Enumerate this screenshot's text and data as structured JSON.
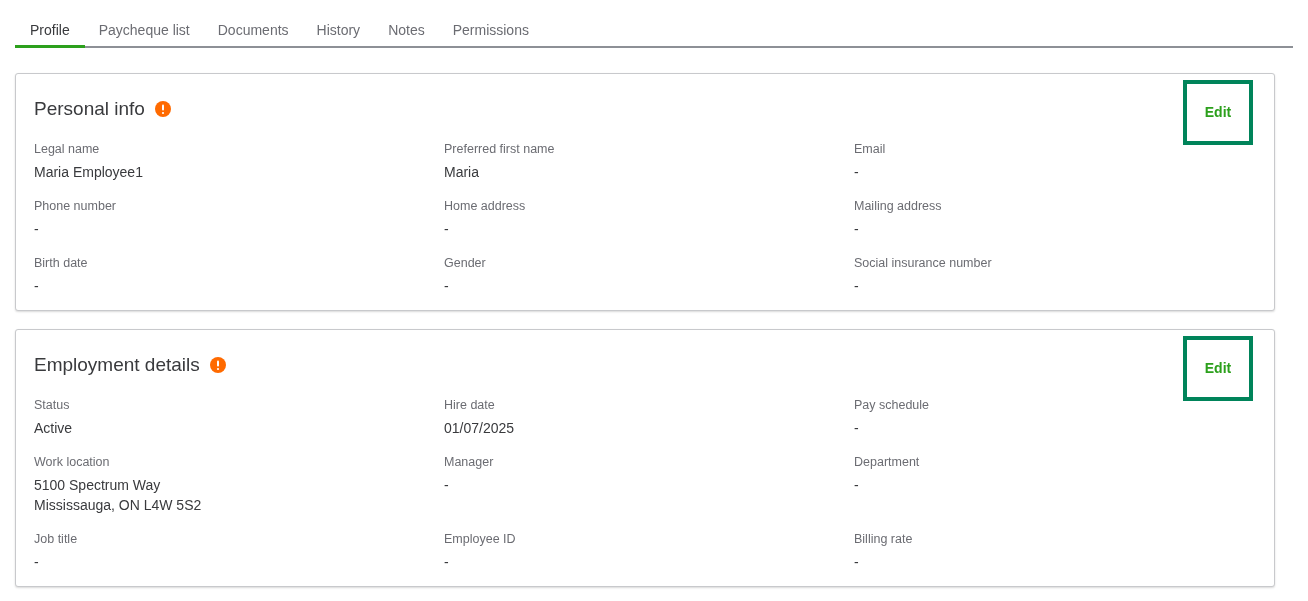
{
  "tabs": [
    {
      "label": "Profile",
      "selected": true
    },
    {
      "label": "Paycheque list",
      "selected": false
    },
    {
      "label": "Documents",
      "selected": false
    },
    {
      "label": "History",
      "selected": false
    },
    {
      "label": "Notes",
      "selected": false
    },
    {
      "label": "Permissions",
      "selected": false
    }
  ],
  "sections": [
    {
      "title": "Personal info",
      "warning": true,
      "edit": {
        "label": "Edit",
        "highlighted": true
      },
      "fields": [
        {
          "label": "Legal name",
          "value": "Maria Employee1"
        },
        {
          "label": "Preferred first name",
          "value": "Maria"
        },
        {
          "label": "Email",
          "value": "-"
        },
        {
          "label": "Phone number",
          "value": "-"
        },
        {
          "label": "Home address",
          "value": "-"
        },
        {
          "label": "Mailing address",
          "value": "-"
        },
        {
          "label": "Birth date",
          "value": "-"
        },
        {
          "label": "Gender",
          "value": "-"
        },
        {
          "label": "Social insurance number",
          "value": "-"
        }
      ]
    },
    {
      "title": "Employment details",
      "warning": true,
      "edit": {
        "label": "Edit",
        "highlighted": true
      },
      "fields": [
        {
          "label": "Status",
          "value": "Active"
        },
        {
          "label": "Hire date",
          "value": "01/07/2025"
        },
        {
          "label": "Pay schedule",
          "value": "-"
        },
        {
          "label": "Work location",
          "value": "5100 Spectrum Way\nMississauga, ON L4W 5S2"
        },
        {
          "label": "Manager",
          "value": "-"
        },
        {
          "label": "Department",
          "value": "-"
        },
        {
          "label": "Job title",
          "value": "-"
        },
        {
          "label": "Employee ID",
          "value": "-"
        },
        {
          "label": "Billing rate",
          "value": "-"
        }
      ]
    }
  ]
}
